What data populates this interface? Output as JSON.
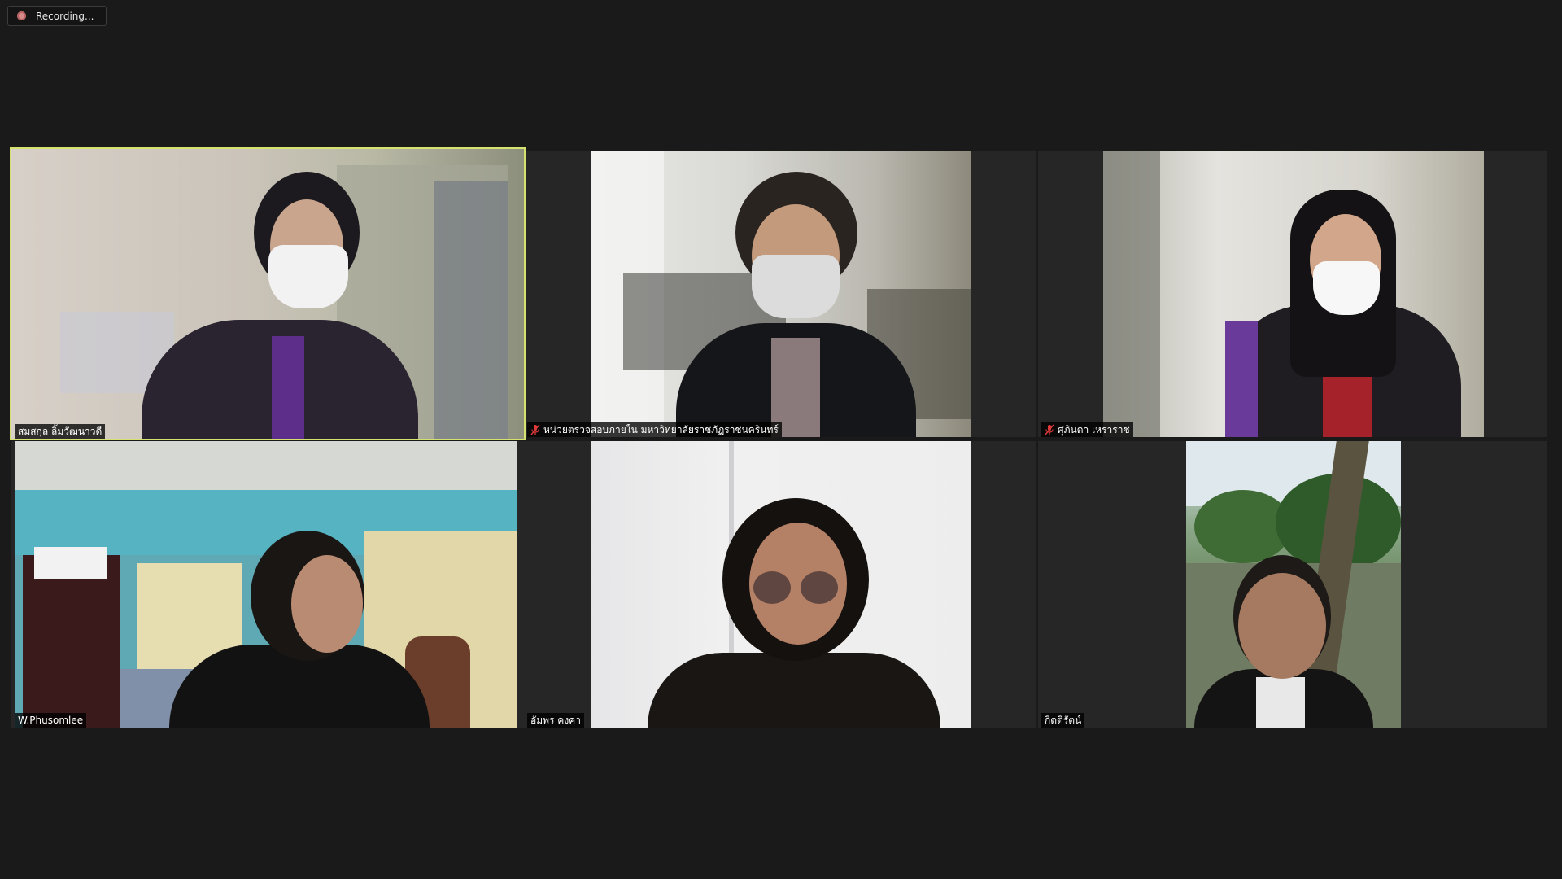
{
  "recording": {
    "label": "Recording..."
  },
  "participants": [
    {
      "name": "สมสกุล ลิ้มวัฒนาวดี",
      "muted": false,
      "active": true
    },
    {
      "name": "หน่วยตรวจสอบภายใน มหาวิทยาลัยราชภัฏราชนครินทร์",
      "muted": true,
      "active": false
    },
    {
      "name": "ศุภินดา เหราราช",
      "muted": true,
      "active": false
    },
    {
      "name": "W.Phusomlee",
      "muted": false,
      "active": false
    },
    {
      "name": "อัมพร คงคา",
      "muted": false,
      "active": false
    },
    {
      "name": "กิตติรัตน์",
      "muted": false,
      "active": false
    }
  ],
  "colors": {
    "background": "#1a1a1a",
    "tile": "#262626",
    "active_speaker_border": "#d6e26e",
    "mute_icon": "#e03a3a"
  }
}
